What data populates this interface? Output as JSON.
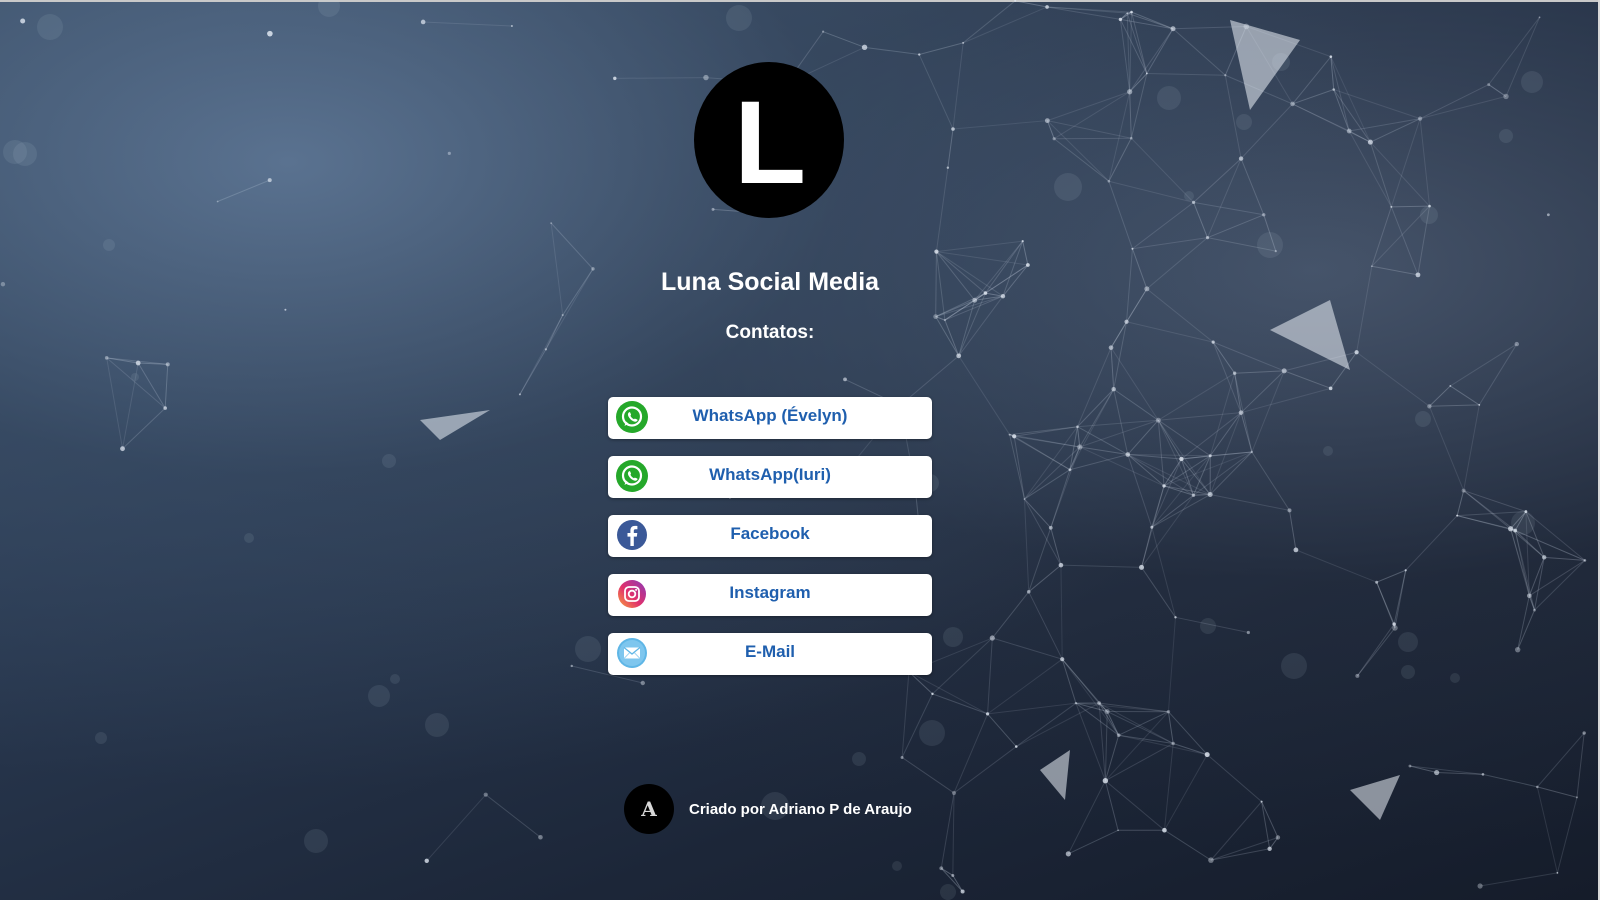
{
  "profile": {
    "logo_letter": "L",
    "title": "Luna Social Media",
    "subtitle": "Contatos:"
  },
  "links": [
    {
      "label": "WhatsApp (Évelyn)",
      "icon": "whatsapp-icon"
    },
    {
      "label": "WhatsApp(Iuri)",
      "icon": "whatsapp-icon"
    },
    {
      "label": "Facebook",
      "icon": "facebook-icon"
    },
    {
      "label": "Instagram",
      "icon": "instagram-icon"
    },
    {
      "label": "E-Mail",
      "icon": "email-icon"
    }
  ],
  "footer": {
    "avatar_letter": "A",
    "credit": "Criado por Adriano P de Araujo"
  },
  "colors": {
    "link_text": "#1f5fae",
    "whatsapp": "#25a82a",
    "facebook": "#3b5998",
    "instagram": "#c13584",
    "email": "#5fb6e6"
  }
}
